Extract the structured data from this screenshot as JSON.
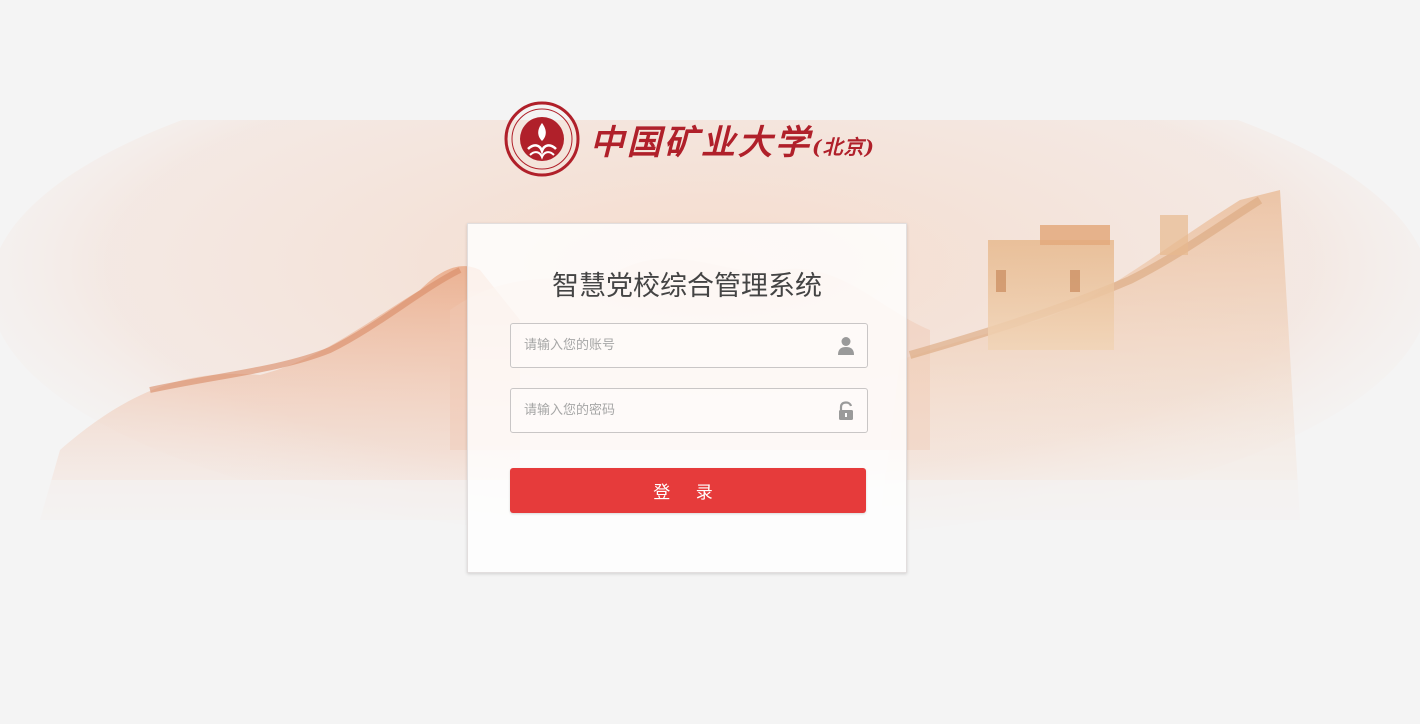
{
  "brand": {
    "university_name": "中国矿业大学",
    "university_suffix": "(北京)",
    "accent_color": "#b0202a"
  },
  "login": {
    "title": "智慧党校综合管理系统",
    "username_placeholder": "请输入您的账号",
    "username_icon": "user-icon",
    "password_placeholder": "请输入您的密码",
    "password_icon": "lock-icon",
    "submit_label": "登 录",
    "submit_color": "#e63b3b"
  }
}
